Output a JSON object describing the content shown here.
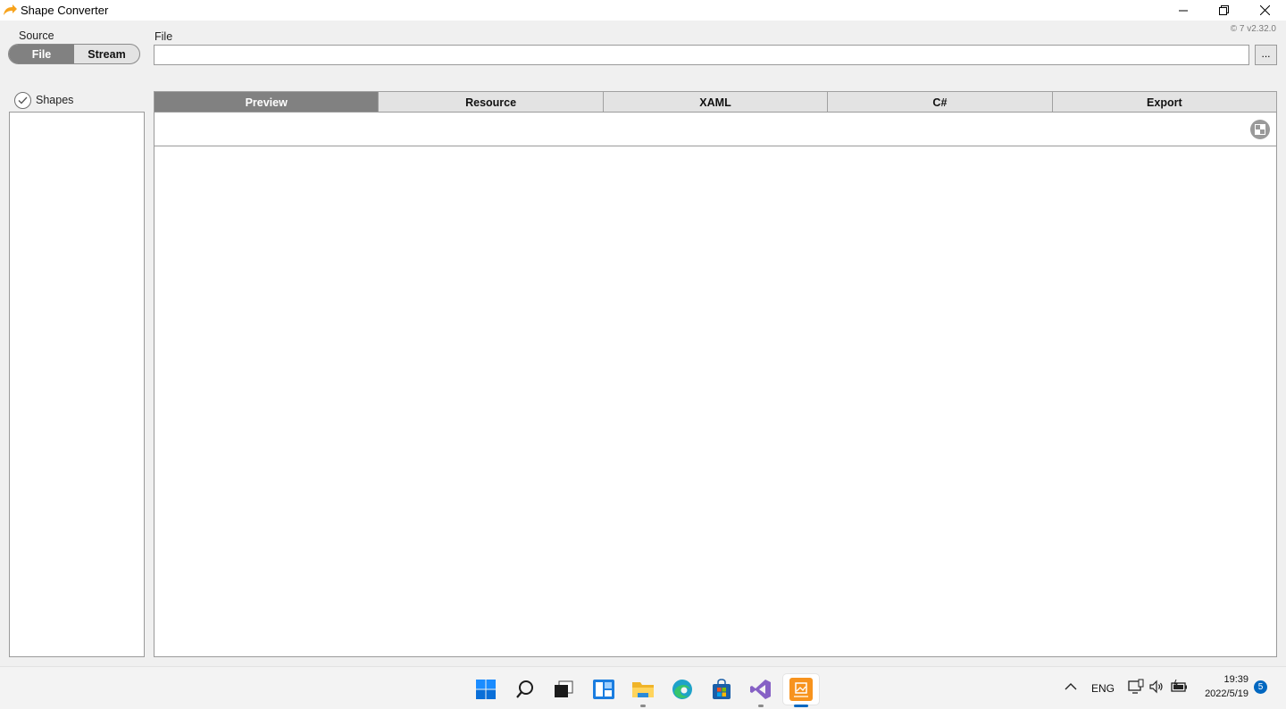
{
  "window": {
    "title": "Shape Converter",
    "version": "© 7 v2.32.0"
  },
  "source": {
    "label": "Source",
    "options": [
      "File",
      "Stream"
    ],
    "selected": "File"
  },
  "file": {
    "label": "File",
    "value": "",
    "browse_label": "..."
  },
  "shapes": {
    "label": "Shapes",
    "checked": true,
    "items": []
  },
  "tabs": [
    {
      "label": "Preview",
      "active": true
    },
    {
      "label": "Resource",
      "active": false
    },
    {
      "label": "XAML",
      "active": false
    },
    {
      "label": "C#",
      "active": false
    },
    {
      "label": "Export",
      "active": false
    }
  ],
  "taskbar": {
    "apps": [
      {
        "name": "start-icon"
      },
      {
        "name": "search-icon"
      },
      {
        "name": "task-view-icon"
      },
      {
        "name": "widgets-icon"
      },
      {
        "name": "file-explorer-icon",
        "running": true
      },
      {
        "name": "edge-icon"
      },
      {
        "name": "store-icon"
      },
      {
        "name": "visual-studio-icon",
        "running": true
      },
      {
        "name": "shape-converter-icon",
        "running": true,
        "active": true
      }
    ],
    "tray": {
      "language": "ENG",
      "time": "19:39",
      "date": "2022/5/19",
      "notifications": "5"
    }
  },
  "colors": {
    "accent": "#818181",
    "taskbar_accent": "#0067c0",
    "app_icon": "#f7a31c"
  }
}
